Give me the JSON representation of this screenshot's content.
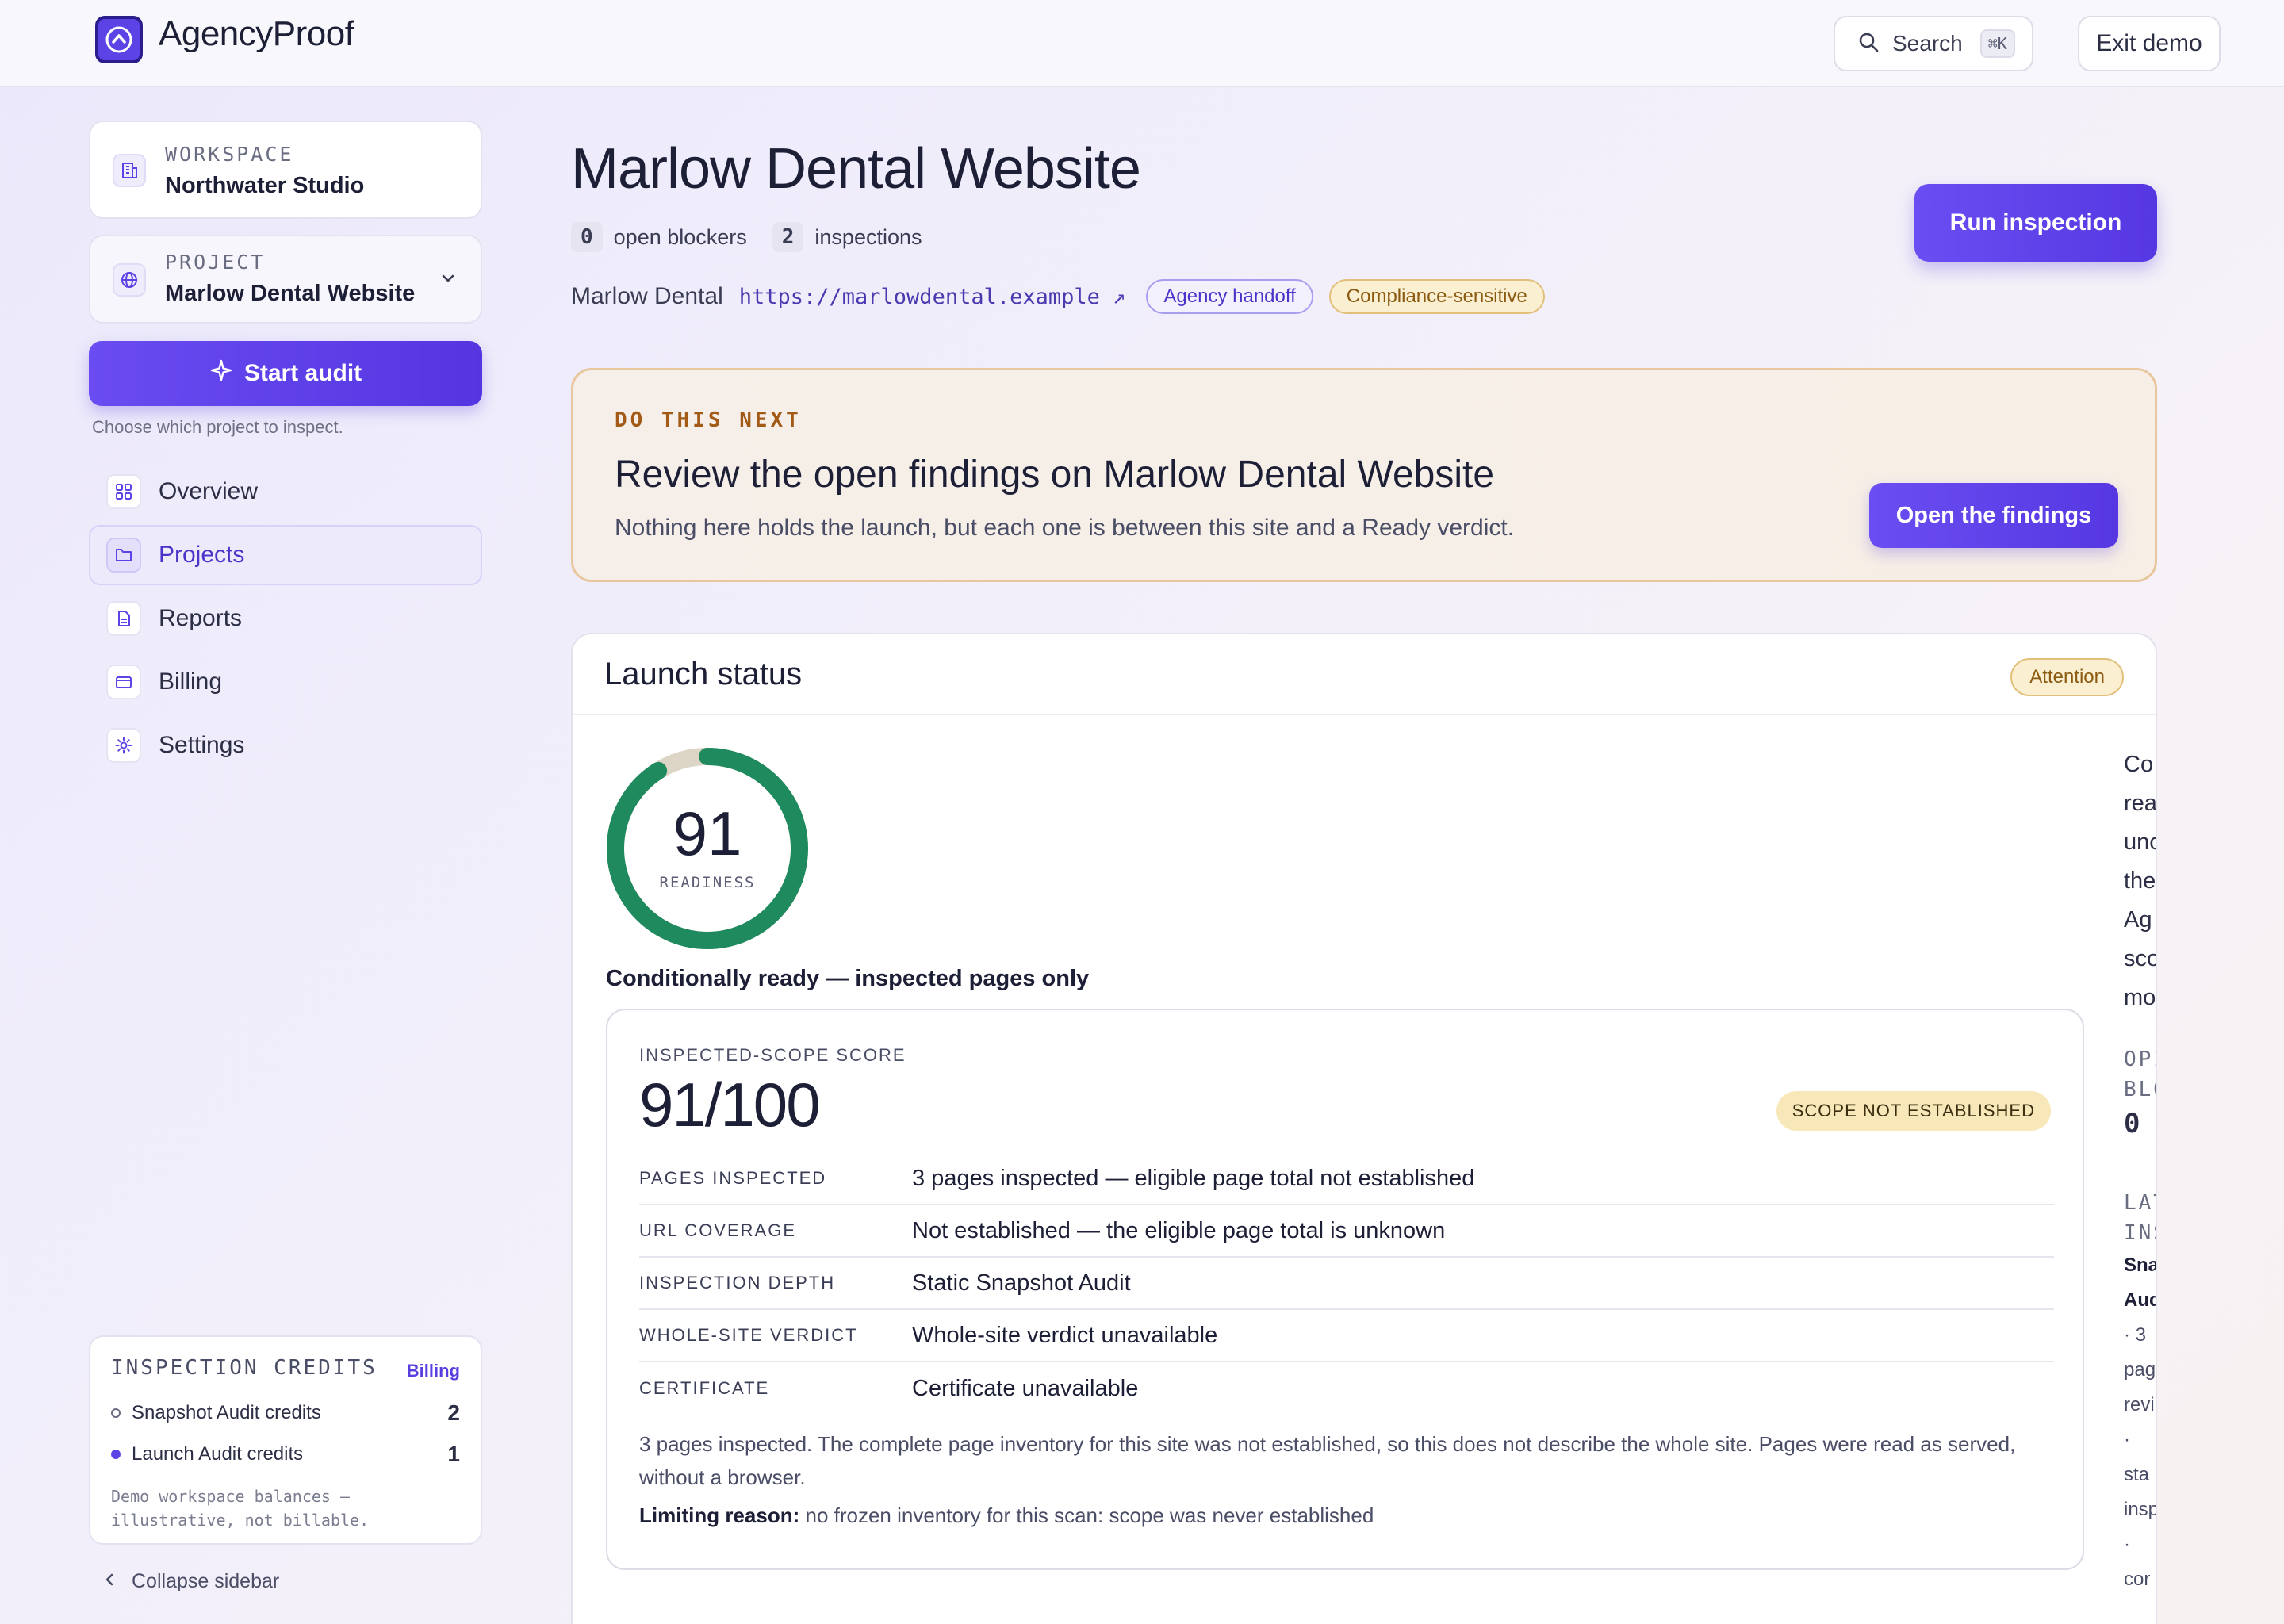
{
  "app": {
    "name": "AgencyProof"
  },
  "topbar": {
    "search_label": "Search",
    "search_shortcut": "⌘K",
    "exit_label": "Exit demo"
  },
  "sidebar": {
    "workspace": {
      "kicker": "WORKSPACE",
      "value": "Northwater Studio"
    },
    "project": {
      "kicker": "PROJECT",
      "value": "Marlow Dental Website"
    },
    "start_audit": "Start audit",
    "start_hint": "Choose which project to inspect.",
    "nav": [
      {
        "label": "Overview",
        "icon": "grid-icon"
      },
      {
        "label": "Projects",
        "icon": "folder-icon",
        "active": true
      },
      {
        "label": "Reports",
        "icon": "document-icon"
      },
      {
        "label": "Billing",
        "icon": "card-icon"
      },
      {
        "label": "Settings",
        "icon": "gear-icon"
      }
    ],
    "credits": {
      "title": "INSPECTION CREDITS",
      "link": "Billing",
      "items": [
        {
          "label": "Snapshot Audit credits",
          "value": "2"
        },
        {
          "label": "Launch Audit credits",
          "value": "1"
        }
      ],
      "note": "Demo workspace balances — illustrative, not billable."
    },
    "collapse": "Collapse sidebar"
  },
  "header": {
    "title": "Marlow Dental Website",
    "blockers_count": "0",
    "blockers_label": "open blockers",
    "inspections_count": "2",
    "inspections_label": "inspections",
    "client": "Marlow Dental",
    "url": "https://marlowdental.example ↗",
    "tags": [
      "Agency handoff",
      "Compliance-sensitive"
    ],
    "run_button": "Run inspection"
  },
  "callout": {
    "kicker": "DO THIS NEXT",
    "title": "Review the open findings on Marlow Dental Website",
    "body": "Nothing here holds the launch, but each one is between this site and a Ready verdict.",
    "button": "Open the findings"
  },
  "launch_status": {
    "title": "Launch status",
    "badge": "Attention",
    "readiness": 91,
    "readiness_value": "91",
    "readiness_label": "READINESS",
    "condition": "Conditionally ready — inspected pages only",
    "score_card": {
      "kicker": "INSPECTED-SCOPE SCORE",
      "score": "91/100",
      "scope_badge": "SCOPE NOT ESTABLISHED",
      "rows": [
        {
          "label": "PAGES INSPECTED",
          "value": "3 pages inspected — eligible page total not established"
        },
        {
          "label": "URL COVERAGE",
          "value": "Not established — the eligible page total is unknown"
        },
        {
          "label": "INSPECTION DEPTH",
          "value": "Static Snapshot Audit"
        },
        {
          "label": "WHOLE-SITE VERDICT",
          "value": "Whole-site verdict unavailable"
        },
        {
          "label": "CERTIFICATE",
          "value": "Certificate unavailable"
        }
      ],
      "note": "3 pages inspected. The complete page inventory for this site was not established, so this does not describe the whole site. Pages were read as served, without a browser.",
      "limit_label": "Limiting reason:",
      "limit_text": "no frozen inventory for this scan: scope was never established"
    },
    "side_column": {
      "lines": [
        "Co",
        "rea",
        "unc",
        "the",
        "Ag",
        "sco",
        "mo"
      ],
      "kicker_1": [
        "OPI",
        "BLO"
      ],
      "blockers_value": "0",
      "kicker_2": [
        "LAT",
        "INS"
      ],
      "bold_lines": [
        "Sna",
        "Aud"
      ],
      "small_lines": [
        "· 3",
        "pag",
        "revi",
        "·",
        "sta",
        "insp",
        "·",
        "cor"
      ]
    }
  }
}
